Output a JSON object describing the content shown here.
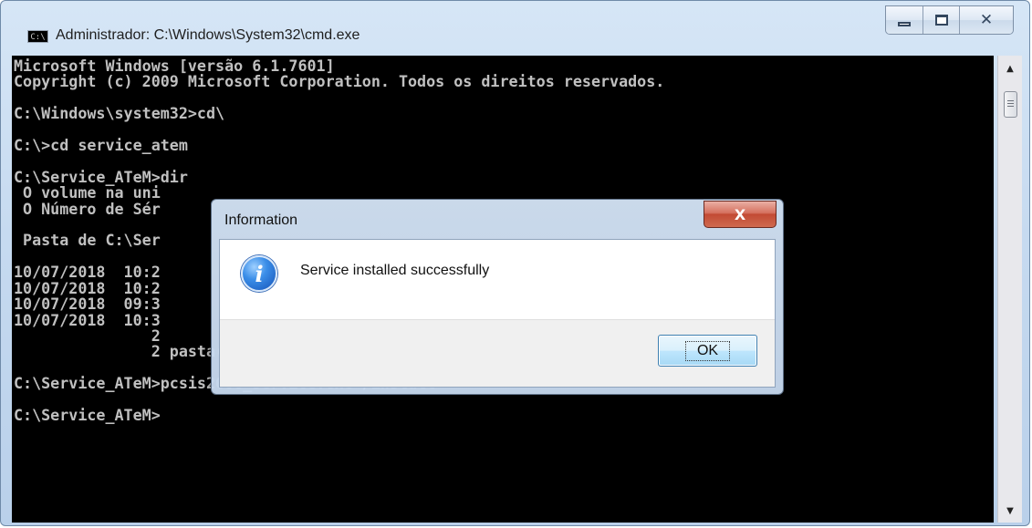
{
  "window": {
    "title": "Administrador: C:\\Windows\\System32\\cmd.exe",
    "icon_text": "C:\\",
    "buttons": {
      "minimize": "minimize-icon",
      "maximize": "maximize-icon",
      "close": "close-icon"
    }
  },
  "console": {
    "lines": [
      "Microsoft Windows [versão 6.1.7601]",
      "Copyright (c) 2009 Microsoft Corporation. Todos os direitos reservados.",
      "",
      "C:\\Windows\\system32>cd\\",
      "",
      "C:\\>cd service_atem",
      "",
      "C:\\Service_ATeM>dir",
      " O volume na uni",
      " O Número de Sér",
      "",
      " Pasta de C:\\Ser",
      "",
      "10/07/2018  10:2",
      "10/07/2018  10:2",
      "10/07/2018  09:3",
      "10/07/2018  10:3                                                   ados_Banco.ini",
      "               2",
      "               2 pasta(s)   387.345.058.304 bytes disponíveis",
      "",
      "C:\\Service_ATeM>pcsis2608_service.exe /install",
      "",
      "C:\\Service_ATeM>"
    ]
  },
  "dialog": {
    "title": "Information",
    "close_glyph": "X",
    "icon": "information-icon",
    "message": "Service installed successfully",
    "ok_label": "OK"
  },
  "scrollbar": {
    "up_arrow": "▲",
    "down_arrow": "▼"
  }
}
